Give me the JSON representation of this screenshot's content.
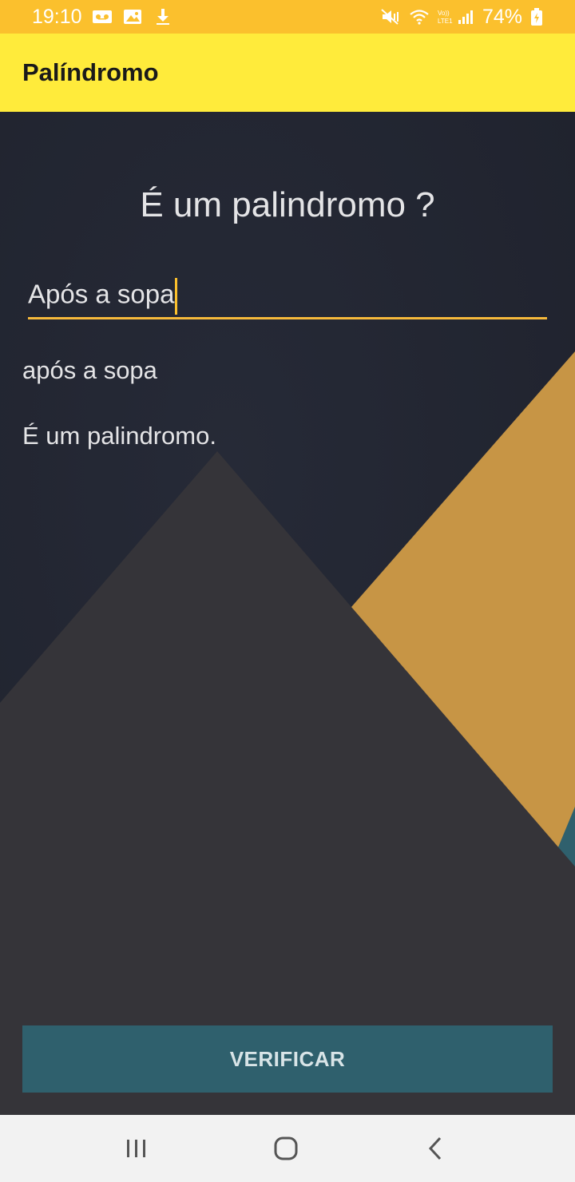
{
  "status_bar": {
    "time": "19:10",
    "battery": "74%",
    "icons_left": [
      "voicemail-icon",
      "image-icon",
      "download-icon"
    ],
    "icons_right": [
      "mute-icon",
      "wifi-icon",
      "lte-signal-icon",
      "battery-charging-icon"
    ]
  },
  "app_bar": {
    "title": "Palíndromo"
  },
  "main": {
    "question": "É um palindromo ?",
    "input_value": "Após a sopa",
    "normalized_text": "após a sopa",
    "result_text": "É um palindromo."
  },
  "actions": {
    "verify_label": "VERIFICAR"
  },
  "nav_bar": {
    "buttons": [
      "recents-icon",
      "home-icon",
      "back-icon"
    ]
  },
  "colors": {
    "status_bar": "#fbc02d",
    "app_bar": "#ffeb3b",
    "background": "#252836",
    "mountain": "#353439",
    "gold_shape": "#c79545",
    "teal_shape": "#2f606d",
    "accent": "#fbc02d",
    "button": "#2f606d"
  }
}
